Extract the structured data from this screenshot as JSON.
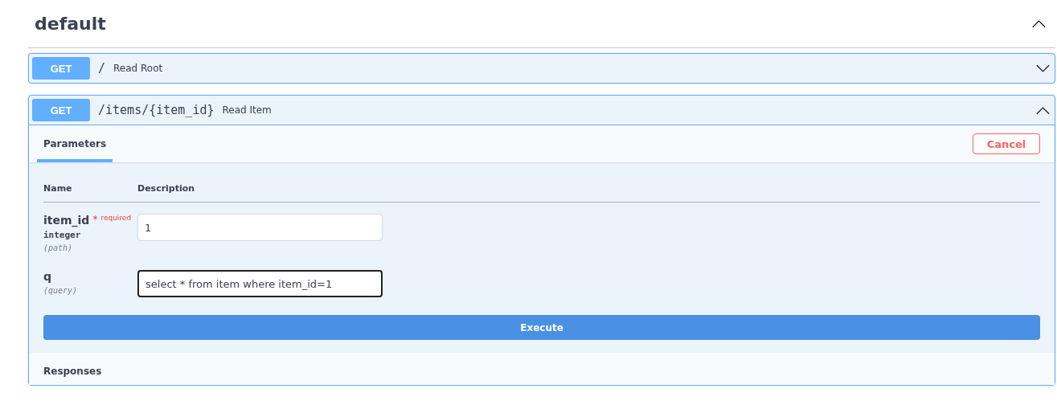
{
  "section": {
    "title": "default",
    "expanded": true
  },
  "operations": [
    {
      "method": "GET",
      "path": "/",
      "summary": "Read Root",
      "expanded": false
    },
    {
      "method": "GET",
      "path": "/items/{item_id}",
      "summary": "Read Item",
      "expanded": true,
      "tabs": [
        {
          "label": "Parameters",
          "selected": true
        }
      ],
      "cancel_button": "Cancel",
      "columns": [
        "Name",
        "Description"
      ],
      "parameters": [
        {
          "name": "item_id",
          "required_mark": "*",
          "required_label": "required",
          "type": "integer",
          "location": "(path)",
          "value": "1",
          "focused": false
        },
        {
          "name": "q",
          "location": "(query)",
          "value": "select * from item where item_id=1",
          "focused": true
        }
      ],
      "execute_button": "Execute",
      "responses_heading": "Responses"
    }
  ]
}
